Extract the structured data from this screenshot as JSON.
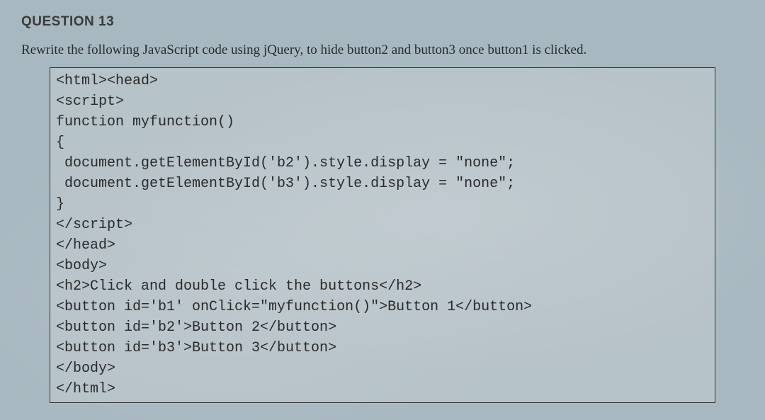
{
  "question": {
    "number_label": "QUESTION 13",
    "prompt": "Rewrite the following JavaScript code using jQuery, to hide button2 and button3 once button1 is clicked."
  },
  "code": {
    "lines": [
      "<html><head>",
      "<script>",
      "function myfunction()",
      "{",
      " document.getElementById('b2').style.display = \"none\";",
      " document.getElementById('b3').style.display = \"none\";",
      "}",
      "</script>",
      "</head>",
      "<body>",
      "<h2>Click and double click the buttons</h2>",
      "<button id='b1' onClick=\"myfunction()\">Button 1</button>",
      "<button id='b2'>Button 2</button>",
      "<button id='b3'>Button 3</button>",
      "</body>",
      "</html>"
    ]
  }
}
